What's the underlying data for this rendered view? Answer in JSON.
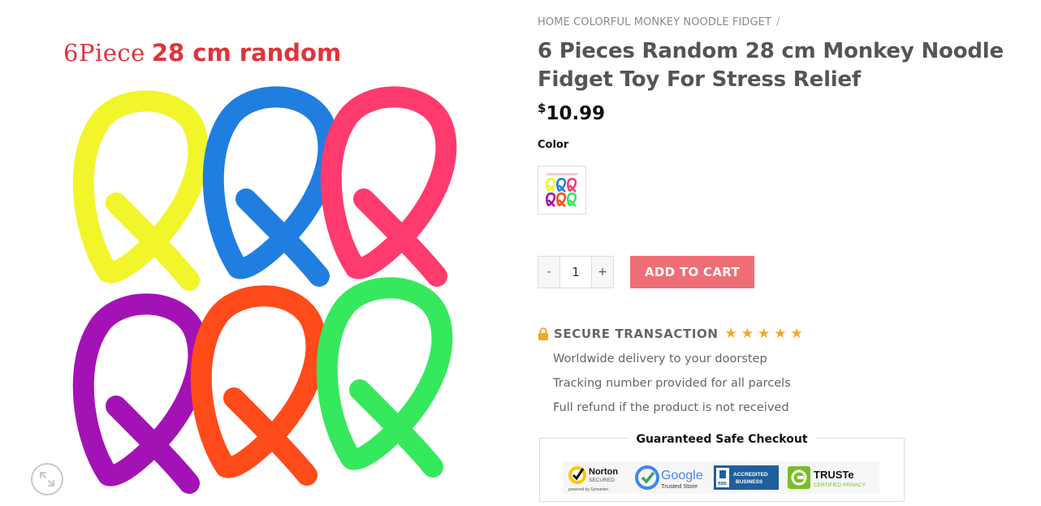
{
  "image": {
    "caption_piece": "6Piece",
    "caption_size": "28 cm random",
    "noodle_colors": [
      "#f2f52a",
      "#1f7ee0",
      "#ff3a6e",
      "#a312b5",
      "#ff4a1a",
      "#36e85c"
    ]
  },
  "breadcrumb": {
    "home": "HOME",
    "category": "COLORFUL MONKEY NOODLE FIDGET",
    "separator": "/"
  },
  "product": {
    "title": "6 Pieces Random 28 cm Monkey Noodle Fidget Toy For Stress Relief",
    "currency": "$",
    "price": "10.99",
    "color_label": "Color"
  },
  "cart": {
    "minus": "-",
    "quantity": "1",
    "plus": "+",
    "add_to_cart": "ADD TO CART",
    "accent": "#ef6e76"
  },
  "secure": {
    "title": "SECURE TRANSACTION",
    "rating": 5,
    "perks": [
      "Worldwide delivery to your doorstep",
      "Tracking number provided for all parcels",
      "Full refund if the product is not received"
    ]
  },
  "checkout": {
    "title": "Guaranteed Safe Checkout",
    "badges": [
      {
        "name": "Norton",
        "line1": "Norton",
        "line2": "SECURED",
        "line3": "powered by Symantec"
      },
      {
        "name": "Google",
        "line1": "Google",
        "line2": "Trusted Store"
      },
      {
        "name": "BBB",
        "line1": "ACCREDITED",
        "line2": "BUSINESS",
        "line3": "BBB"
      },
      {
        "name": "TRUSTe",
        "line1": "TRUSTe",
        "line2": "CERTIFIED PRIVACY"
      }
    ]
  }
}
